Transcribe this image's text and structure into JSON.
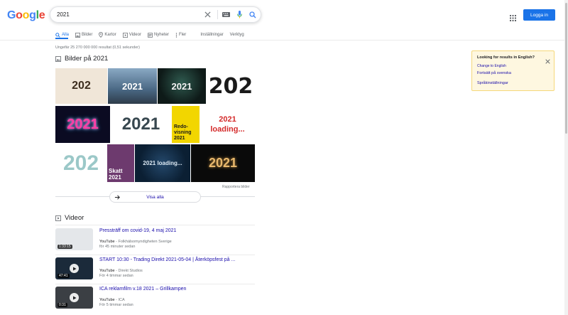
{
  "logo": {
    "letters": [
      "G",
      "o",
      "o",
      "g",
      "l",
      "e"
    ],
    "colors": [
      "#4285f4",
      "#ea4335",
      "#fbbc05",
      "#4285f4",
      "#34a853",
      "#ea4335"
    ]
  },
  "search": {
    "query": "2021"
  },
  "header": {
    "login_label": "Logga in"
  },
  "tabs": [
    {
      "label": "Alla",
      "icon": "search-icon",
      "active": true
    },
    {
      "label": "Bilder",
      "icon": "image-icon"
    },
    {
      "label": "Kartor",
      "icon": "map-pin-icon"
    },
    {
      "label": "Videor",
      "icon": "video-icon"
    },
    {
      "label": "Nyheter",
      "icon": "news-icon"
    },
    {
      "label": "Fler",
      "icon": "more-vert-icon"
    },
    {
      "label": "Inställningar"
    },
    {
      "label": "Verktyg"
    }
  ],
  "result_stats": "Ungefär 25 270 000 000 resultat (0,51 sekunder)",
  "images_section": {
    "title": "Bilder på 2021",
    "tiles": [
      {
        "text": "202",
        "bg": "#f0e6d8",
        "fg": "#3d2e1f"
      },
      {
        "text": "2021",
        "bg": "#5b7b9a",
        "fg": "#ffffff"
      },
      {
        "text": "2021",
        "bg": "#0e1a18",
        "fg": "#f2f2f2"
      },
      {
        "text": "202",
        "bg": "#ffffff",
        "fg": "#1a1a1a"
      },
      {
        "text": "2021",
        "bg": "#0b0b22",
        "fg": "#ff3ea5"
      },
      {
        "text": "2021",
        "bg": "#ffffff",
        "fg": "#37474f"
      },
      {
        "text": "Redo-visning 2021",
        "bg": "#f2d600",
        "fg": "#1a1a1a"
      },
      {
        "text": "2021 loading...",
        "bg": "#ffffff",
        "fg": "#d42a2a"
      },
      {
        "text": "202",
        "bg": "#ffffff",
        "fg": "#9bc8c8"
      },
      {
        "text": "Skatt 2021",
        "bg": "#6d3a6e",
        "fg": "#ffffff"
      },
      {
        "text": "2021 loading...",
        "bg": "#0b1f33",
        "fg": "#dce8f2"
      },
      {
        "text": "2021",
        "bg": "#0a0a0a",
        "fg": "#e8b86d"
      }
    ],
    "report_label": "Rapportera bilder",
    "see_all_label": "Visa alla"
  },
  "videos_section": {
    "title": "Videor",
    "items": [
      {
        "title": "Pressträff om covid-19, 4 maj 2021",
        "source": "YouTube",
        "channel": "Folkhälsomyndigheten Sverige",
        "time": "för 45 minuter sedan",
        "duration": "1:33:15",
        "thumb_bg": "#e4e7ea"
      },
      {
        "title": "START 10:30 - Trading Direkt 2021-05-04 | Återköpsfest på ...",
        "source": "YouTube",
        "channel": "Direkt Studios",
        "time": "För 4 timmar sedan",
        "duration": "47:41",
        "thumb_bg": "#1b2a3a"
      },
      {
        "title": "ICA reklamfilm v.18 2021 – Grillkampen",
        "source": "YouTube",
        "channel": "ICA",
        "time": "För 5 timmar sedan",
        "duration": "0:31",
        "thumb_bg": "#3b3f44"
      }
    ]
  },
  "language_box": {
    "question": "Looking for results in English?",
    "change_link": "Change to English",
    "continue_link": "Fortsätt på svenska",
    "settings_link": "Språkinställningar"
  },
  "colors": {
    "accent": "#1a73e8",
    "link": "#1a0dab",
    "muted": "#70757a"
  }
}
